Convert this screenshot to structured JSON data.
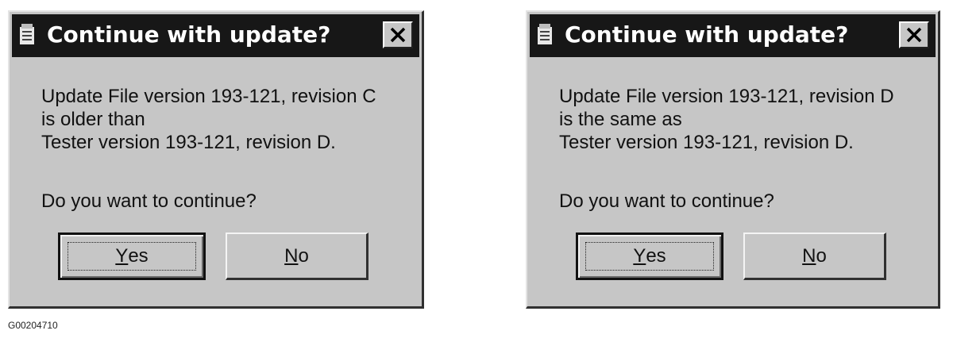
{
  "dialogs": [
    {
      "title": "Continue with update?",
      "message_lines": [
        "Update File version 193-121, revision C",
        "is older than",
        "Tester version 193-121, revision D."
      ],
      "question": "Do you want to continue?",
      "yes_mnemonic": "Y",
      "yes_rest": "es",
      "no_mnemonic": "N",
      "no_rest": "o",
      "title_icon": "app-icon",
      "close_icon": "close-x-icon"
    },
    {
      "title": "Continue with update?",
      "message_lines": [
        "Update File version 193-121, revision D",
        "is the same as",
        "Tester version 193-121, revision D."
      ],
      "question": "Do you want to continue?",
      "yes_mnemonic": "Y",
      "yes_rest": "es",
      "no_mnemonic": "N",
      "no_rest": "o",
      "title_icon": "app-icon",
      "close_icon": "close-x-icon"
    }
  ],
  "caption": "G00204710",
  "colors": {
    "dialog_face": "#c6c6c6",
    "titlebar": "#171717",
    "title_text": "#ffffff"
  }
}
